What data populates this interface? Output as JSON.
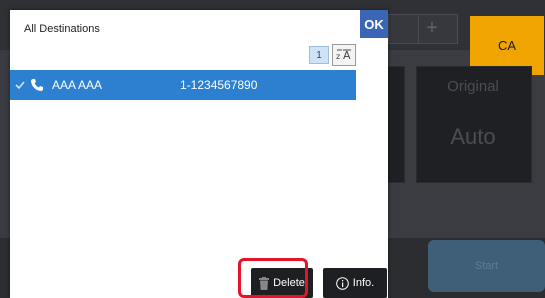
{
  "background": {
    "ca_label": "CA",
    "original_label": "Original",
    "auto_label": "Auto",
    "start_label": "Start",
    "plus_label": "+"
  },
  "dialog": {
    "title": "All Destinations",
    "ok_label": "OK",
    "page_number": "1",
    "sort_icon": "sort-icon",
    "destinations": [
      {
        "name": "AAA AAA",
        "number": "1-1234567890",
        "type_icon": "phone-icon",
        "selected": true
      }
    ],
    "delete_label": "Delete",
    "info_label": "Info."
  },
  "colors": {
    "ok_button": "#3a66b5",
    "selected_row": "#2d7fd0",
    "ca_button": "#f0a400",
    "highlight": "#e4152a"
  }
}
